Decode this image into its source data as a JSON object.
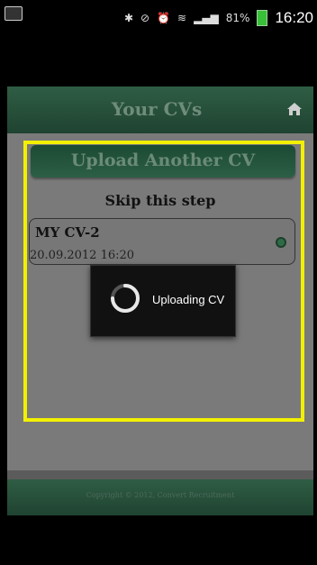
{
  "status_bar": {
    "time": "16:20",
    "battery": "81%",
    "icons": [
      "gallery-icon",
      "bluetooth-icon",
      "mute-icon",
      "alarm-icon",
      "wifi-icon",
      "signal-icon",
      "battery-icon"
    ]
  },
  "header": {
    "title": "Your CVs",
    "home_icon": "home-icon"
  },
  "main": {
    "upload_label": "Upload Another CV",
    "skip_label": "Skip this step",
    "cv_list": [
      {
        "title": "MY CV-2",
        "date": "20.09.2012 16:20"
      }
    ]
  },
  "modal": {
    "text": "Uploading CV"
  },
  "footer": {
    "text": "Copyright © 2012, Convert Recruitment"
  },
  "colors": {
    "highlight": "#f2f000",
    "header_green": "#1f4331"
  }
}
